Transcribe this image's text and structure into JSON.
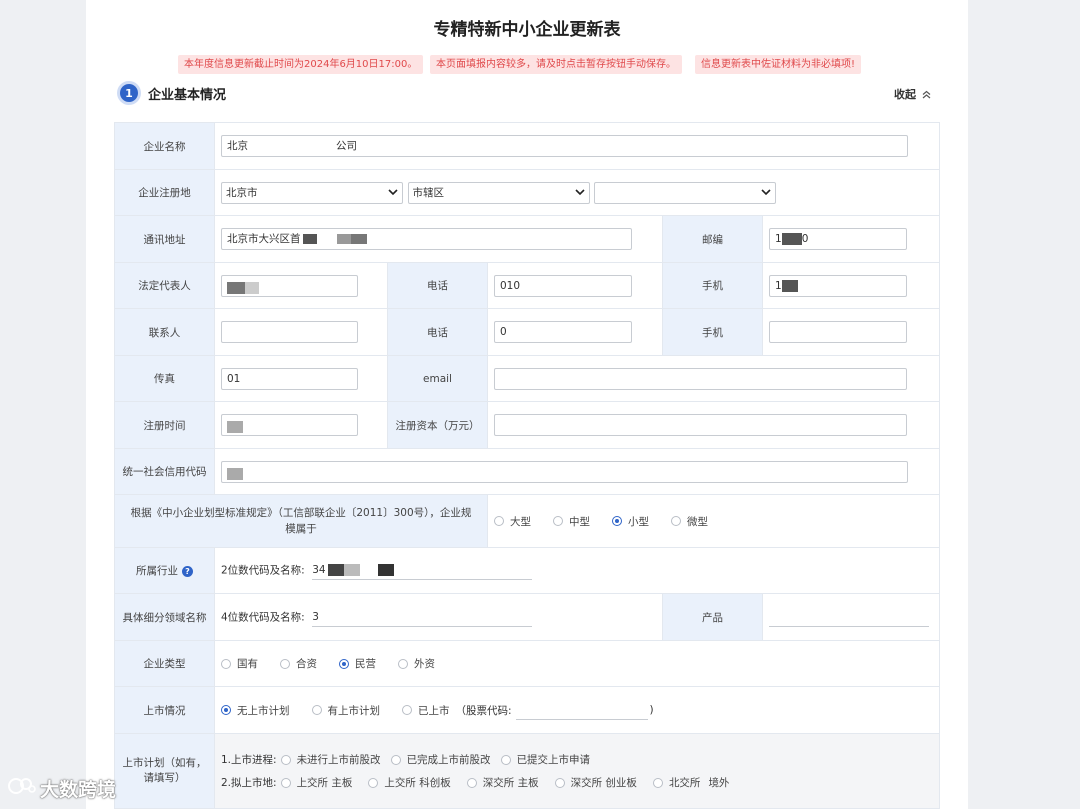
{
  "page": {
    "title": "专精特新中小企业更新表"
  },
  "notices": [
    "本年度信息更新截止时间为2024年6月10日17:00。",
    "本页面填报内容较多，请及时点击暂存按钮手动保存。",
    "信息更新表中佐证材料为非必填项!"
  ],
  "section": {
    "number": "1",
    "title": "企业基本情况",
    "collapse_label": "收起"
  },
  "fields": {
    "company_name": {
      "label": "企业名称",
      "value": "北京"
    },
    "company_name_suffix": "公司",
    "registration": {
      "label": "企业注册地",
      "province": "北京市",
      "city": "市辖区",
      "district": ""
    },
    "address": {
      "label": "通讯地址",
      "value": "北京市大兴区首"
    },
    "postcode": {
      "label": "邮编",
      "value": "1"
    },
    "postcode_tail": "0",
    "legal_rep": {
      "label": "法定代表人",
      "value": "",
      "phone_label": "电话",
      "phone": "010",
      "mobile_label": "手机",
      "mobile": "1"
    },
    "contact": {
      "label": "联系人",
      "value": "",
      "phone_label": "电话",
      "phone": "0",
      "mobile_label": "手机",
      "mobile": ""
    },
    "fax": {
      "label": "传真",
      "value": "01",
      "email_label": "email",
      "email": ""
    },
    "reg_date": {
      "label": "注册时间",
      "value": "",
      "capital_label": "注册资本（万元）",
      "capital": ""
    },
    "credit_code": {
      "label": "统一社会信用代码",
      "value": ""
    },
    "scale": {
      "label": "根据《中小企业划型标准规定》（工信部联企业〔2011〕300号），企业规模属于",
      "options": [
        "大型",
        "中型",
        "小型",
        "微型"
      ],
      "selected": "小型"
    },
    "industry": {
      "label": "所属行业",
      "help": "?",
      "code_label": "2位数代码及名称:",
      "code_value": "34"
    },
    "subfield": {
      "label": "具体细分领域名称",
      "code_label": "4位数代码及名称:",
      "code_value": "3",
      "product_label": "产品",
      "product_value": ""
    },
    "enterprise_type": {
      "label": "企业类型",
      "options": [
        "国有",
        "合资",
        "民营",
        "外资"
      ],
      "selected": "民营"
    },
    "listing": {
      "label": "上市情况",
      "options": [
        "无上市计划",
        "有上市计划",
        "已上市"
      ],
      "selected": "无上市计划",
      "stock_code_label": "（股票代码:",
      "stock_code_close": ")"
    },
    "listing_plan": {
      "label": "上市计划（如有，请填写）",
      "progress_label": "1.上市进程:",
      "progress_options": [
        "未进行上市前股改",
        "已完成上市前股改",
        "已提交上市申请"
      ],
      "venue_label": "2.拟上市地:",
      "venue_options": [
        "上交所 主板",
        "上交所 科创板",
        "深交所 主板",
        "深交所 创业板",
        "北交所",
        "境外"
      ]
    }
  },
  "watermark": "大数跨境",
  "colors": {
    "accent": "#2f64c8",
    "notice_bg": "#fde3e3",
    "notice_text": "#e0494b",
    "label_bg": "#eaf1fb"
  }
}
